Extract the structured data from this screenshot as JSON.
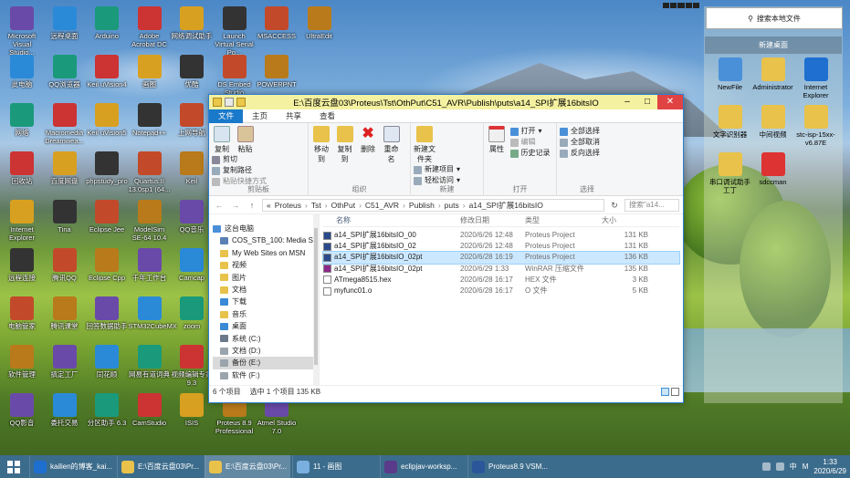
{
  "desktop": {
    "col1": [
      "Microsoft Visual Studio...",
      "此电脑",
      "网络",
      "回收站",
      "Internet Explorer",
      "远程连接",
      "电脑管家",
      "软件管理",
      "QQ影音"
    ],
    "col2": [
      "远程桌面",
      "QQ浏览器",
      "Macromedia Dreamwea...",
      "百度网盘",
      "Tina",
      "腾讯QQ",
      "腾讯课堂",
      "搞定工厂",
      "委托交易"
    ],
    "col3": [
      "Arduino",
      "Keil uVision4",
      "Keil uVision5",
      "phpstudy_pro",
      "Eclipse Jee",
      "Eclipse Cpp",
      "回答数据助手",
      "同花顺",
      "分区助手 6.3"
    ],
    "col4": [
      "Adobe Acrobat DC",
      "画图",
      "Notepad++",
      "Quartus II 13.0sp1 (64...",
      "ModelSim SE-64 10.4",
      "千年工作台",
      "STM32CubeMX",
      "网易有道词典",
      "CamStudio"
    ],
    "col5": [
      "网络调试助手",
      "优酷",
      "上网导航",
      "Keil",
      "QQ音乐",
      "Camcap",
      "zoom",
      "视频编辑专家 9.3",
      "ISIS"
    ],
    "col6": [
      "Launch Virtual Serial Po...",
      "DS Embed Studio",
      "Proteus 8.9 Professional"
    ],
    "col7": [
      "MSACCESS",
      "POWERPNT",
      "Atmel Studio 7.0"
    ],
    "col8": [
      "UltraEdit"
    ]
  },
  "window": {
    "title": "E:\\百度云盘03\\Proteus\\Tst\\OthPut\\C51_AVR\\Publish\\puts\\a14_SPI扩展16bitsIO",
    "tabs": [
      "文件",
      "主页",
      "共享",
      "查看"
    ],
    "ribbon": {
      "clipboard": {
        "label": "剪贴板",
        "copy": "复制",
        "paste": "粘贴",
        "cut": "剪切",
        "copy_path": "复制路径",
        "paste_shortcut": "粘贴快捷方式"
      },
      "organize": {
        "label": "组织",
        "move_to": "移动到",
        "copy_to": "复制到",
        "delete": "删除",
        "rename": "重命名"
      },
      "new": {
        "label": "新建",
        "new_folder": "新建文件夹",
        "new_item": "新建项目",
        "easy_access": "轻松访问"
      },
      "open": {
        "label": "打开",
        "properties": "属性",
        "open": "打开",
        "edit": "编辑",
        "history": "历史记录"
      },
      "select": {
        "label": "选择",
        "select_all": "全部选择",
        "select_none": "全部取消",
        "invert": "反向选择"
      }
    },
    "breadcrumb": [
      "«",
      "Proteus",
      "Tst",
      "OthPut",
      "C51_AVR",
      "Publish",
      "puts",
      "a14_SPI扩展16bitsIO"
    ],
    "search_placeholder": "搜索\"a14...",
    "nav": [
      {
        "label": "这台电脑",
        "color": "#4a90d9"
      },
      {
        "label": "COS_STB_100: Media Serv",
        "color": "#5a7fb5"
      },
      {
        "label": "My Web Sites on MSN",
        "color": "#e8c24a"
      },
      {
        "label": "视频",
        "color": "#e8c24a"
      },
      {
        "label": "图片",
        "color": "#e8c24a"
      },
      {
        "label": "文档",
        "color": "#e8c24a"
      },
      {
        "label": "下载",
        "color": "#3a8ad6"
      },
      {
        "label": "音乐",
        "color": "#e8c24a"
      },
      {
        "label": "桌面",
        "color": "#3a8ad6"
      },
      {
        "label": "系统 (C:)",
        "color": "#6a7a8a"
      },
      {
        "label": "文档 (D:)",
        "color": "#9aa4ad"
      },
      {
        "label": "备份 (E:)",
        "color": "#9aa4ad"
      },
      {
        "label": "软件 (F:)",
        "color": "#9aa4ad"
      }
    ],
    "nav_selected": 11,
    "columns": [
      "名称",
      "修改日期",
      "类型",
      "大小"
    ],
    "files": [
      {
        "name": "a14_SPI扩展16bitsIO_00",
        "date": "2020/6/26 12:48",
        "type": "Proteus Project",
        "size": "131 KB",
        "icon": "#2a4a8a"
      },
      {
        "name": "a14_SPI扩展16bitsIO_02",
        "date": "2020/6/26 12:48",
        "type": "Proteus Project",
        "size": "131 KB",
        "icon": "#2a4a8a"
      },
      {
        "name": "a14_SPI扩展16bitsIO_02pt",
        "date": "2020/6/28 16:19",
        "type": "Proteus Project",
        "size": "136 KB",
        "icon": "#2a4a8a"
      },
      {
        "name": "a14_SPI扩展16bitsIO_02pt",
        "date": "2020/6/29 1:33",
        "type": "WinRAR 压缩文件",
        "size": "135 KB",
        "icon": "#8b2a8a"
      },
      {
        "name": "ATmega8515.hex",
        "date": "2020/6/28 16:17",
        "type": "HEX 文件",
        "size": "3 KB",
        "icon": "#ffffff"
      },
      {
        "name": "myfunc01.o",
        "date": "2020/6/28 16:17",
        "type": "O 文件",
        "size": "5 KB",
        "icon": "#ffffff"
      }
    ],
    "selected_row": 2,
    "status": {
      "count": "6 个项目",
      "selected": "选中 1 个项目  135 KB"
    }
  },
  "right_panel": {
    "search": "搜索本地文件",
    "folder_title": "新建桌面",
    "items": [
      "NewFile",
      "Administrator",
      "Internet Explorer",
      "文字识别器",
      "中间视频",
      "stc-isp-15xx-v6.87E",
      "串口调试助手工丁",
      "sdccman"
    ]
  },
  "taskbar": {
    "buttons": [
      {
        "label": "kailien的博客_kai...",
        "color": "#1e6fd0"
      },
      {
        "label": "E:\\百度云盘03\\Pr...",
        "color": "#e8c24a"
      },
      {
        "label": "E:\\百度云盘03\\Pr...",
        "color": "#e8c24a"
      },
      {
        "label": "11 - 画图",
        "color": "#7ab0e0"
      },
      {
        "label": "eclipjav-worksp...",
        "color": "#5a3a8a"
      },
      {
        "label": "Proteus8.9 VSM...",
        "color": "#2b579a"
      }
    ],
    "active_button": 2,
    "ime": "中",
    "ime2": "M",
    "time": "1:33",
    "date": "2020/6/29"
  }
}
